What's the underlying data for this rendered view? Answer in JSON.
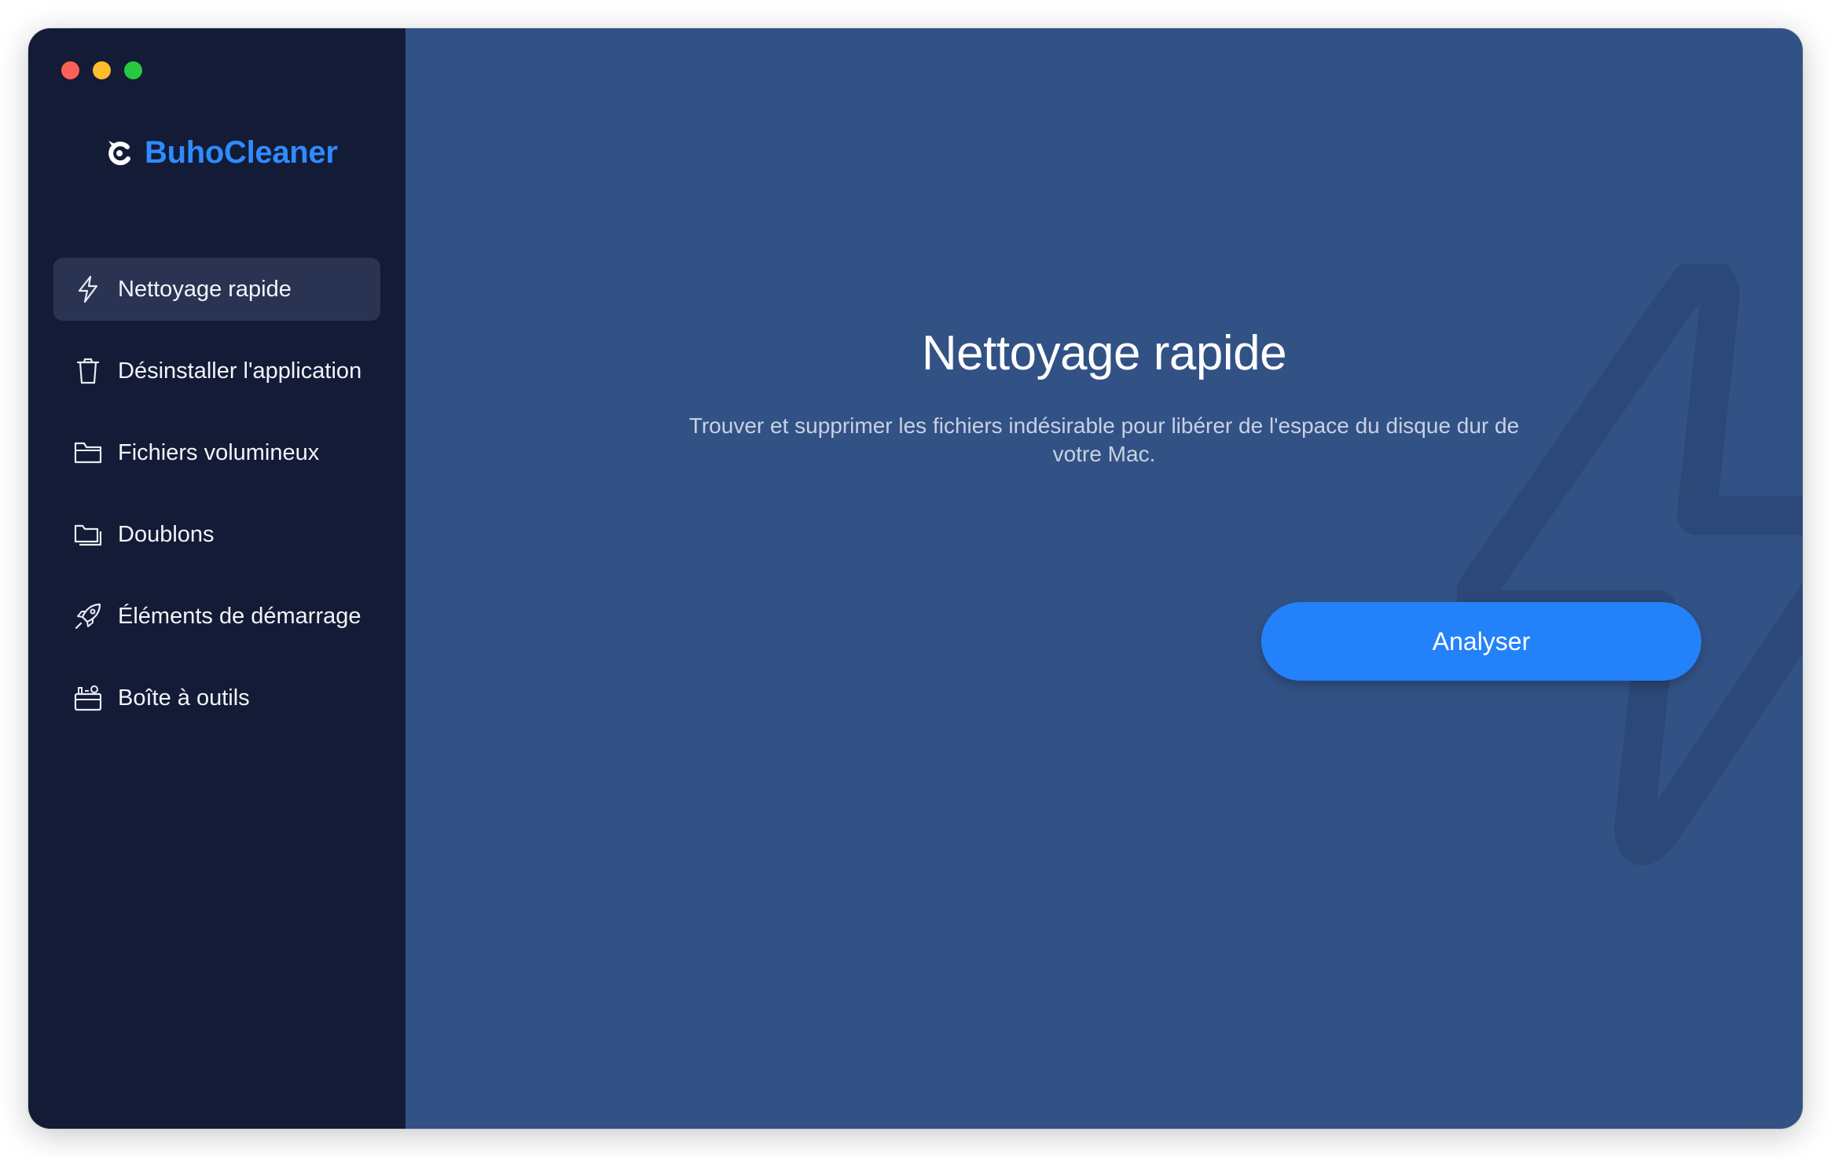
{
  "app": {
    "name": "BuhoCleaner",
    "brand_color": "#2f8bff"
  },
  "window_controls": [
    "close",
    "minimize",
    "zoom"
  ],
  "sidebar": {
    "items": [
      {
        "label": "Nettoyage rapide",
        "icon": "bolt-icon",
        "active": true
      },
      {
        "label": "Désinstaller l'application",
        "icon": "trash-icon",
        "active": false
      },
      {
        "label": "Fichiers volumineux",
        "icon": "folder-icon",
        "active": false
      },
      {
        "label": "Doublons",
        "icon": "duplicate-folders-icon",
        "active": false
      },
      {
        "label": "Éléments de démarrage",
        "icon": "rocket-icon",
        "active": false
      },
      {
        "label": "Boîte à outils",
        "icon": "toolbox-icon",
        "active": false
      }
    ]
  },
  "main": {
    "title": "Nettoyage rapide",
    "description": "Trouver et supprimer les fichiers indésirable pour libérer de l'espace du disque dur de votre Mac.",
    "primary_button": "Analyser",
    "accent_color": "#2381fa",
    "background_color": "#325286"
  }
}
